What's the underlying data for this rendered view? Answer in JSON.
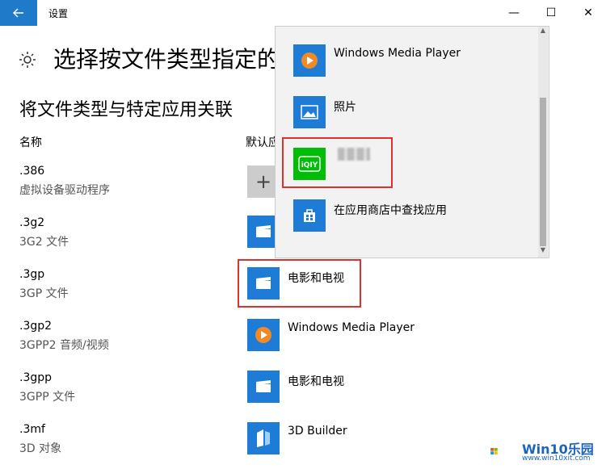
{
  "window": {
    "title": "设置",
    "back_icon": "arrow-left-icon",
    "minimize": "—",
    "maximize": "☐",
    "close": "✕"
  },
  "page": {
    "heading": "选择按文件类型指定的",
    "subheading": "将文件类型与特定应用关联",
    "col_name": "名称",
    "col_default": "默认应"
  },
  "rows": [
    {
      "ext": ".386",
      "desc": "虚拟设备驱动程序",
      "app": ""
    },
    {
      "ext": ".3g2",
      "desc": "3G2 文件",
      "app": ""
    },
    {
      "ext": ".3gp",
      "desc": "3GP 文件",
      "app": "电影和电视"
    },
    {
      "ext": ".3gp2",
      "desc": "3GPP2 音频/视频",
      "app": "Windows Media Player"
    },
    {
      "ext": ".3gpp",
      "desc": "3GPP 文件",
      "app": "电影和电视"
    },
    {
      "ext": ".3mf",
      "desc": "3D 对象",
      "app": "3D Builder"
    }
  ],
  "popup": {
    "items": [
      {
        "label": "Windows Media Player",
        "icon": "media-player-icon"
      },
      {
        "label": "照片",
        "icon": "photos-icon"
      },
      {
        "label": "",
        "icon": "iqiyi-icon"
      },
      {
        "label": "在应用商店中查找应用",
        "icon": "store-icon"
      }
    ]
  },
  "watermark": {
    "brand": "Win10乐园",
    "url": "www.win10xit.com"
  },
  "colors": {
    "accent": "#1e7cd6",
    "highlight": "#e03030",
    "iqiyi": "#00be06"
  }
}
